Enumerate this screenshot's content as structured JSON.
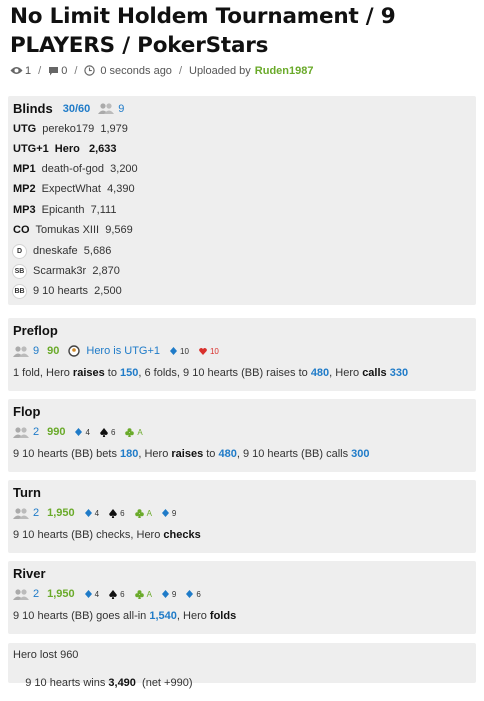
{
  "title": "No Limit Holdem Tournament / 9 PLAYERS / PokerStars",
  "meta": {
    "views": "1",
    "comments": "0",
    "time": "0 seconds ago",
    "uploaded_by": "Uploaded by",
    "user": "Ruden1987",
    "sep": "/"
  },
  "blinds": {
    "label": "Blinds",
    "value": "30/60",
    "players": "9",
    "seats": [
      {
        "pos": "UTG",
        "name": "pereko179",
        "stack": "1,979"
      },
      {
        "pos": "UTG+1",
        "name": "Hero",
        "stack": "2,633"
      },
      {
        "pos": "MP1",
        "name": "death-of-god",
        "stack": "3,200"
      },
      {
        "pos": "MP2",
        "name": "ExpectWhat",
        "stack": "4,390"
      },
      {
        "pos": "MP3",
        "name": "Epicanth",
        "stack": "7,111"
      },
      {
        "pos": "CO",
        "name": "Tomukas XIII",
        "stack": "9,569"
      },
      {
        "pos": "D",
        "name": "dneskafe",
        "stack": "5,686"
      },
      {
        "pos": "SB",
        "name": "Scarmak3r",
        "stack": "2,870"
      },
      {
        "pos": "BB",
        "name": "9 10 hearts",
        "stack": "2,500"
      }
    ]
  },
  "preflop": {
    "label": "Preflop",
    "players": "9",
    "pot": "90",
    "hero_label": "Hero is UTG+1",
    "cards": [
      {
        "rank": "10",
        "suit": "diamond",
        "color": "#1f7bc8"
      },
      {
        "rank": "10",
        "suit": "heart",
        "color": "#d9302c"
      }
    ],
    "a": [
      "1 fold, Hero ",
      "raises",
      " to ",
      "150",
      ", 6 folds, 9 10 hearts (BB) raises to ",
      "480",
      ", Hero ",
      "calls",
      " ",
      "330"
    ]
  },
  "flop": {
    "label": "Flop",
    "players": "2",
    "pot": "990",
    "cards": [
      {
        "rank": "4",
        "suit": "diamond",
        "color": "#1f7bc8"
      },
      {
        "rank": "6",
        "suit": "spade",
        "color": "#111111"
      },
      {
        "rank": "A",
        "suit": "club",
        "color": "#6aaa2a"
      }
    ],
    "a": [
      "9 10 hearts (BB) bets ",
      "180",
      ", Hero ",
      "raises",
      " to ",
      "480",
      ", 9 10 hearts (BB) calls ",
      "300"
    ]
  },
  "turn": {
    "label": "Turn",
    "players": "2",
    "pot": "1,950",
    "cards": [
      {
        "rank": "4",
        "suit": "diamond",
        "color": "#1f7bc8"
      },
      {
        "rank": "6",
        "suit": "spade",
        "color": "#111111"
      },
      {
        "rank": "A",
        "suit": "club",
        "color": "#6aaa2a"
      },
      {
        "rank": "9",
        "suit": "diamond",
        "color": "#1f7bc8"
      }
    ],
    "a": [
      "9 10 hearts (BB) checks, Hero ",
      "checks"
    ]
  },
  "river": {
    "label": "River",
    "players": "2",
    "pot": "1,950",
    "cards": [
      {
        "rank": "4",
        "suit": "diamond",
        "color": "#1f7bc8"
      },
      {
        "rank": "6",
        "suit": "spade",
        "color": "#111111"
      },
      {
        "rank": "A",
        "suit": "club",
        "color": "#6aaa2a"
      },
      {
        "rank": "9",
        "suit": "diamond",
        "color": "#1f7bc8"
      },
      {
        "rank": "6",
        "suit": "diamond",
        "color": "#1f7bc8"
      }
    ],
    "a": [
      "9 10 hearts (BB) goes all-in ",
      "1,540",
      ", Hero ",
      "folds"
    ]
  },
  "summary": {
    "line1": "Hero lost 960",
    "line2_a": "9 10 hearts wins ",
    "line2_b": "3,490",
    "line2_c": "  (net +990)"
  }
}
